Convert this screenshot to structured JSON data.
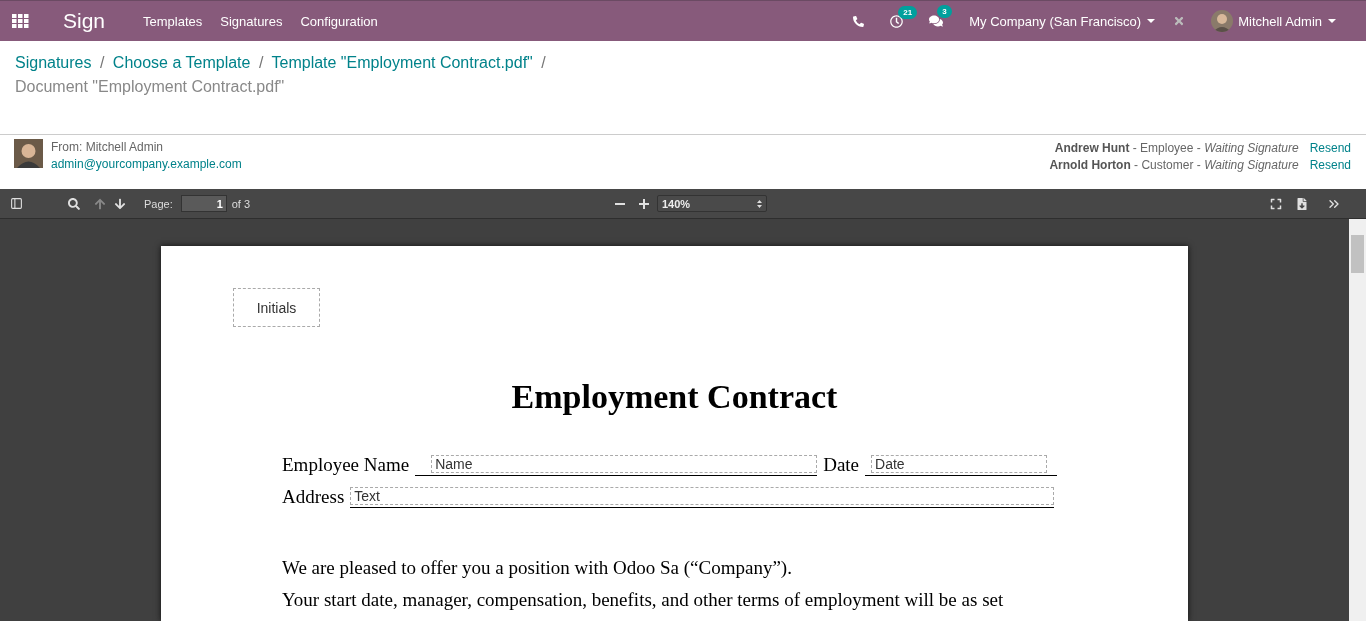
{
  "navbar": {
    "app_name": "Sign",
    "menu": [
      "Templates",
      "Signatures",
      "Configuration"
    ],
    "activity_count": "21",
    "message_count": "3",
    "company": "My Company (San Francisco)",
    "user": "Mitchell Admin"
  },
  "breadcrumb_separator": "/",
  "breadcrumbs": [
    {
      "label": "Signatures",
      "current": false
    },
    {
      "label": "Choose a Template",
      "current": false
    },
    {
      "label": "Template \"Employment Contract.pdf\"",
      "current": false
    },
    {
      "label": "Document \"Employment Contract.pdf\"",
      "current": true
    }
  ],
  "sender": {
    "from": "From: Mitchell Admin",
    "email": "admin@yourcompany.example.com"
  },
  "signers": [
    {
      "text": "**Andrew Hunt** - Employee - *Waiting Signature*",
      "action": "Resend"
    },
    {
      "text": "**Arnold Horton** - Customer - *Waiting Signature*",
      "action": "Resend"
    }
  ],
  "pdf_toolbar": {
    "page_label": "Page:",
    "page": "1",
    "page_count": "of 3",
    "zoom": "140%"
  },
  "document": {
    "initials_field": "Initials",
    "title": "Employment Contract",
    "lines": [
      {
        "label": "Employee Name",
        "field": "Name",
        "label2": "Date",
        "field2": "Date"
      },
      {
        "label": "Address",
        "field": "Text"
      }
    ],
    "paragraphs": [
      "We are pleased to offer you a position with Odoo Sa (“Company”).",
      "Your start date, manager, compensation, benefits, and other terms of employment will be as set"
    ]
  }
}
